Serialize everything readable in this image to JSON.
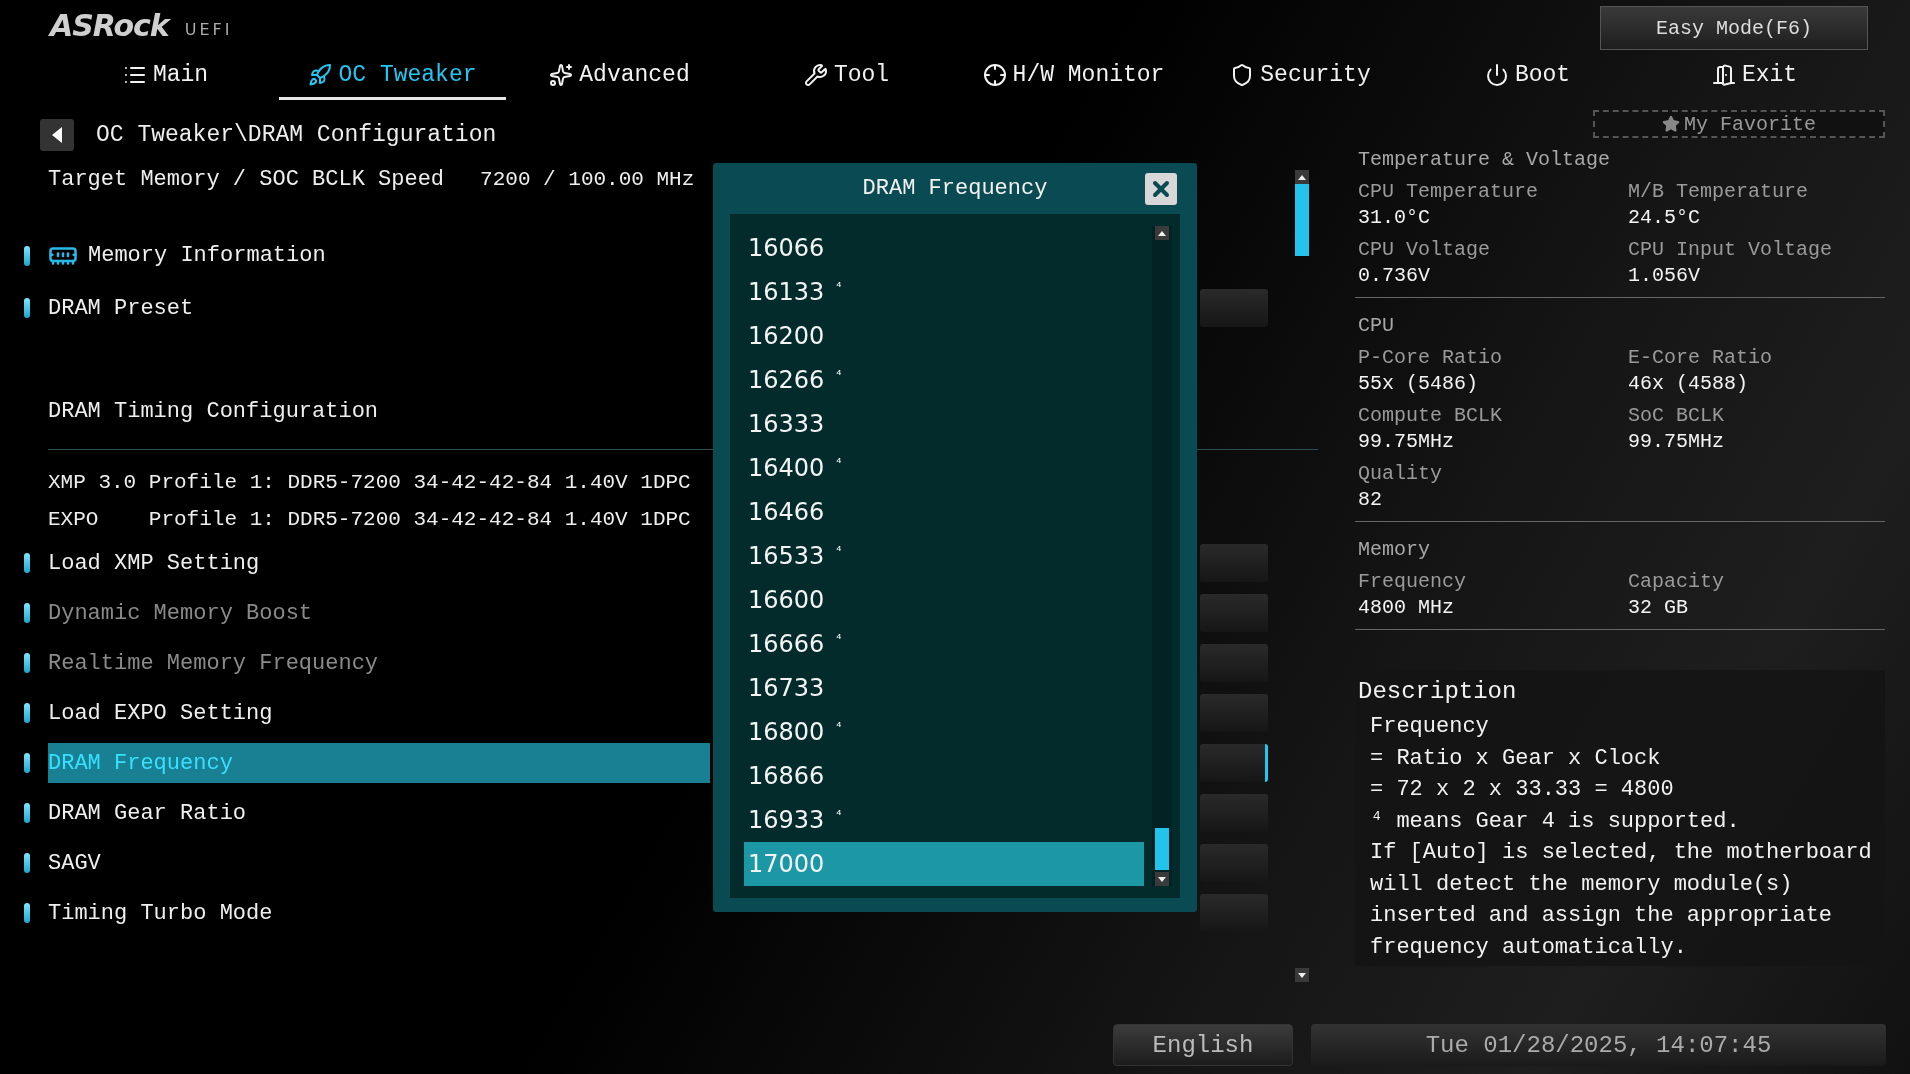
{
  "logo": {
    "brand": "ASRock",
    "product": "UEFI"
  },
  "easy_mode_button": "Easy Mode(F6)",
  "tabs": [
    {
      "label": "Main",
      "selected": false
    },
    {
      "label": "OC Tweaker",
      "selected": true
    },
    {
      "label": "Advanced",
      "selected": false
    },
    {
      "label": "Tool",
      "selected": false
    },
    {
      "label": "H/W Monitor",
      "selected": false
    },
    {
      "label": "Security",
      "selected": false
    },
    {
      "label": "Boot",
      "selected": false
    },
    {
      "label": "Exit",
      "selected": false
    }
  ],
  "favorite_button": "My Favorite",
  "breadcrumb": "OC Tweaker\\DRAM Configuration",
  "target": {
    "label": "Target Memory / SOC BCLK Speed",
    "value": "7200 / 100.00 MHz"
  },
  "menu": [
    {
      "kind": "page",
      "label": "Memory Information",
      "selected": false,
      "disabled": false
    },
    {
      "kind": "option",
      "label": "DRAM Preset",
      "selected": false,
      "disabled": false
    },
    {
      "kind": "heading",
      "label": "DRAM Timing Configuration"
    },
    {
      "kind": "profile",
      "label": "XMP 3.0 Profile 1: DDR5-7200 34-42-42-84 1.40V 1DPC"
    },
    {
      "kind": "profile",
      "label": "EXPO    Profile 1: DDR5-7200 34-42-42-84 1.40V 1DPC"
    },
    {
      "kind": "option",
      "label": "Load XMP Setting",
      "selected": false,
      "disabled": false
    },
    {
      "kind": "option",
      "label": "Dynamic Memory Boost",
      "selected": false,
      "disabled": true
    },
    {
      "kind": "option",
      "label": "Realtime Memory Frequency",
      "selected": false,
      "disabled": true
    },
    {
      "kind": "option",
      "label": "Load EXPO Setting",
      "selected": false,
      "disabled": false
    },
    {
      "kind": "option",
      "label": "DRAM Frequency",
      "selected": true,
      "disabled": false
    },
    {
      "kind": "option",
      "label": "DRAM Gear Ratio",
      "selected": false,
      "disabled": false
    },
    {
      "kind": "option",
      "label": "SAGV",
      "selected": false,
      "disabled": false
    },
    {
      "kind": "option",
      "label": "Timing Turbo Mode",
      "selected": false,
      "disabled": false
    }
  ],
  "popup": {
    "title": "DRAM Frequency",
    "items": [
      {
        "value": "16066",
        "selected": false
      },
      {
        "value": "16133",
        "mark": "⁴",
        "selected": false
      },
      {
        "value": "16200",
        "selected": false
      },
      {
        "value": "16266",
        "mark": "⁴",
        "selected": false
      },
      {
        "value": "16333",
        "selected": false
      },
      {
        "value": "16400",
        "mark": "⁴",
        "selected": false
      },
      {
        "value": "16466",
        "selected": false
      },
      {
        "value": "16533",
        "mark": "⁴",
        "selected": false
      },
      {
        "value": "16600",
        "selected": false
      },
      {
        "value": "16666",
        "mark": "⁴",
        "selected": false
      },
      {
        "value": "16733",
        "selected": false
      },
      {
        "value": "16800",
        "mark": "⁴",
        "selected": false
      },
      {
        "value": "16866",
        "selected": false
      },
      {
        "value": "16933",
        "mark": "⁴",
        "selected": false
      },
      {
        "value": "17000",
        "selected": true
      }
    ]
  },
  "info_sections": [
    {
      "title": "Temperature & Voltage",
      "fields": [
        {
          "label": "CPU Temperature",
          "value": "31.0°C"
        },
        {
          "label": "M/B Temperature",
          "value": "24.5°C"
        },
        {
          "label": "CPU Voltage",
          "value": "0.736V"
        },
        {
          "label": "CPU Input Voltage",
          "value": "1.056V"
        }
      ]
    },
    {
      "title": "CPU",
      "fields": [
        {
          "label": "P-Core Ratio",
          "value": "55x (5486)"
        },
        {
          "label": "E-Core Ratio",
          "value": "46x (4588)"
        },
        {
          "label": "Compute BCLK",
          "value": "99.75MHz"
        },
        {
          "label": "SoC BCLK",
          "value": "99.75MHz"
        },
        {
          "label": "Quality",
          "value": "82"
        }
      ]
    },
    {
      "title": "Memory",
      "fields": [
        {
          "label": "Frequency",
          "value": "4800 MHz"
        },
        {
          "label": "Capacity",
          "value": "32 GB"
        }
      ]
    }
  ],
  "description": {
    "title": "Description",
    "lines": [
      "Frequency",
      "= Ratio x Gear x Clock",
      "= 72 x 2 x 33.33 = 4800",
      "⁴ means Gear 4 is supported.",
      "If [Auto] is selected, the motherboard",
      "will detect the memory module(s)",
      "inserted and assign the appropriate",
      "frequency automatically."
    ]
  },
  "language_button": "English",
  "datetime": "Tue 01/28/2025, 14:07:45"
}
